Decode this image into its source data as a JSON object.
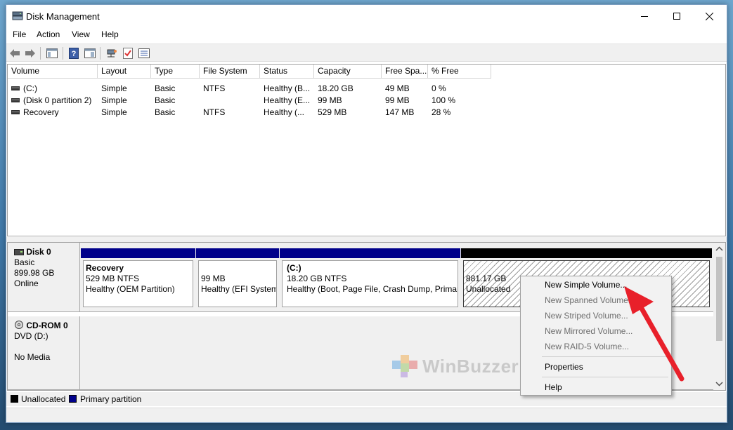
{
  "window": {
    "title": "Disk Management"
  },
  "menu": [
    "File",
    "Action",
    "View",
    "Help"
  ],
  "toolbar": [
    "back-arrow-icon",
    "forward-arrow-icon",
    "console-tree-icon",
    "help-icon",
    "show-hide-icon",
    "connect-icon",
    "checklist-icon",
    "properties-list-icon"
  ],
  "list": {
    "columns": [
      "Volume",
      "Layout",
      "Type",
      "File System",
      "Status",
      "Capacity",
      "Free Spa...",
      "% Free"
    ],
    "rows": [
      [
        "(C:)",
        "Simple",
        "Basic",
        "NTFS",
        "Healthy (B...",
        "18.20 GB",
        "49 MB",
        "0 %"
      ],
      [
        "(Disk 0 partition 2)",
        "Simple",
        "Basic",
        "",
        "Healthy (E...",
        "99 MB",
        "99 MB",
        "100 %"
      ],
      [
        "Recovery",
        "Simple",
        "Basic",
        "NTFS",
        "Healthy (...",
        "529 MB",
        "147 MB",
        "28 %"
      ]
    ]
  },
  "disks": {
    "disk0": {
      "name": "Disk 0",
      "type": "Basic",
      "size": "899.98 GB",
      "state": "Online",
      "partitions": [
        {
          "name": "Recovery",
          "size": "529 MB NTFS",
          "status": "Healthy (OEM Partition)"
        },
        {
          "name": "",
          "size": "99 MB",
          "status": "Healthy (EFI System"
        },
        {
          "name": "(C:)",
          "size": "18.20 GB NTFS",
          "status": "Healthy (Boot, Page File, Crash Dump, Primar"
        },
        {
          "name": "",
          "size": "881.17 GB",
          "status": "Unallocated"
        }
      ]
    },
    "cdrom0": {
      "name": "CD-ROM 0",
      "type": "DVD (D:)",
      "state": "No Media"
    }
  },
  "legend": [
    {
      "label": "Unallocated",
      "color": "#000000"
    },
    {
      "label": "Primary partition",
      "color": "#00008a"
    }
  ],
  "context_menu": {
    "items": [
      {
        "label": "New Simple Volume...",
        "enabled": true
      },
      {
        "label": "New Spanned Volume...",
        "enabled": false
      },
      {
        "label": "New Striped Volume...",
        "enabled": false
      },
      {
        "label": "New Mirrored Volume...",
        "enabled": false
      },
      {
        "label": "New RAID-5 Volume...",
        "enabled": false
      },
      {
        "label": "Properties",
        "enabled": true
      },
      {
        "label": "Help",
        "enabled": true
      }
    ]
  },
  "watermark": {
    "text": "WinBuzzer"
  },
  "colors": {
    "primary_partition": "#00008a",
    "annotation_arrow": "#e8202a"
  }
}
